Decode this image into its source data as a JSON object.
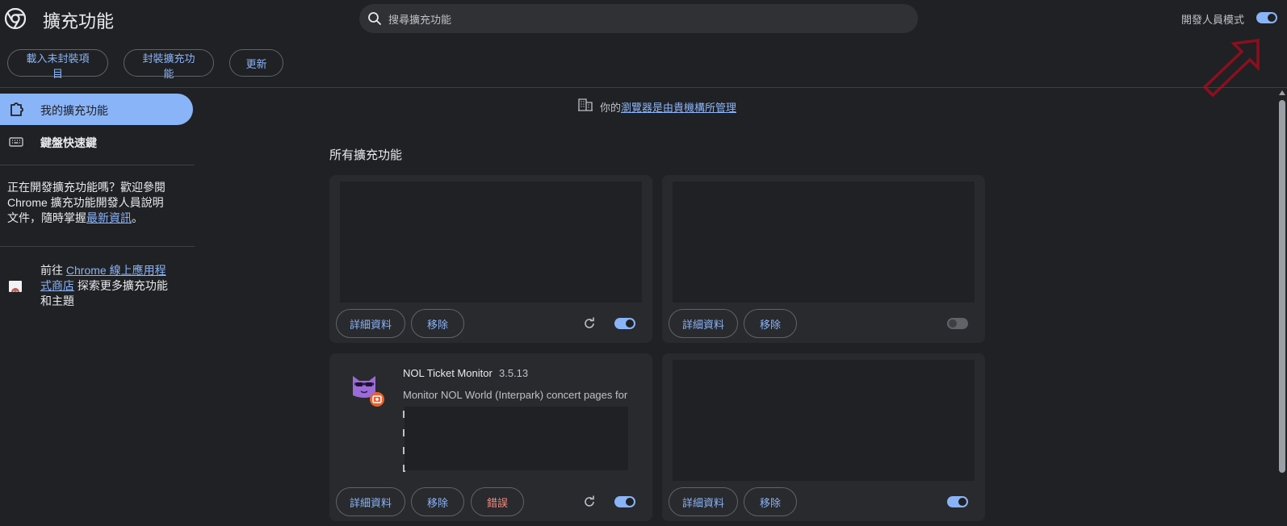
{
  "header": {
    "title": "擴充功能",
    "search_placeholder": "搜尋擴充功能",
    "dev_mode_label": "開發人員模式",
    "dev_mode_on": true
  },
  "toolbar": {
    "load_unpacked": "載入未封裝項目",
    "pack_extension": "封裝擴充功能",
    "update": "更新"
  },
  "sidebar": {
    "items": [
      {
        "label": "我的擴充功能",
        "icon": "puzzle-icon",
        "active": true
      },
      {
        "label": "鍵盤快速鍵",
        "icon": "keyboard-icon",
        "active": false
      }
    ],
    "dev_text_prefix": "正在開發擴充功能嗎？歡迎參閱 Chrome 擴充功能開發人員說明文件，隨時掌握",
    "dev_link": "最新資訊",
    "dev_text_suffix": "。",
    "store_prefix": "前往 ",
    "store_link": "Chrome 線上應用程式商店",
    "store_suffix": " 探索更多擴充功能和主題"
  },
  "managed": {
    "prefix": "你的",
    "link": "瀏覽器是由貴機構所管理"
  },
  "main": {
    "section_title": "所有擴充功能",
    "details_label": "詳細資料",
    "remove_label": "移除",
    "errors_label": "錯誤",
    "cards": [
      {
        "blank": true,
        "enabled": true,
        "reload": true
      },
      {
        "blank": true,
        "enabled": false,
        "reload": false
      },
      {
        "blank": false,
        "name": "NOL Ticket Monitor",
        "version": "3.5.13",
        "description": "Monitor NOL World (Interpark) concert pages for",
        "enabled": true,
        "reload": true,
        "errors": true
      },
      {
        "blank": true,
        "enabled": true,
        "reload": false
      }
    ]
  },
  "colors": {
    "background": "#202124",
    "card": "#292a2d",
    "accent": "#8ab4f8",
    "error": "#f28b82",
    "annotation_arrow": "#8b0f1e"
  }
}
